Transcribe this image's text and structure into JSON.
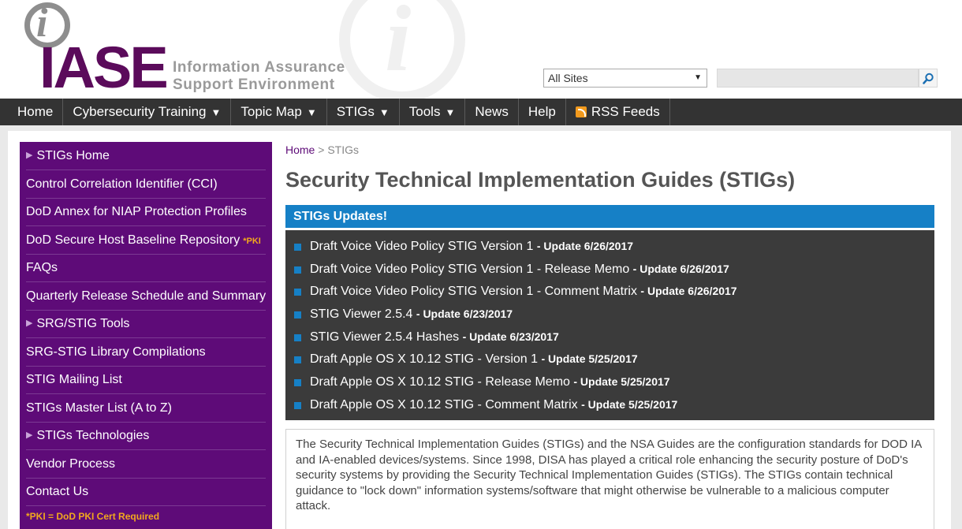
{
  "header": {
    "logo_wordmark": "IASE",
    "tagline_line1": "Information Assurance",
    "tagline_line2": "Support Environment",
    "site_select_value": "All Sites",
    "search_value": ""
  },
  "nav": {
    "items": [
      {
        "label": "Home",
        "dropdown": false
      },
      {
        "label": "Cybersecurity Training",
        "dropdown": true
      },
      {
        "label": "Topic Map",
        "dropdown": true
      },
      {
        "label": "STIGs",
        "dropdown": true
      },
      {
        "label": "Tools",
        "dropdown": true
      },
      {
        "label": "News",
        "dropdown": false
      },
      {
        "label": "Help",
        "dropdown": false
      },
      {
        "label": "RSS Feeds",
        "dropdown": false,
        "icon": "rss-icon"
      }
    ],
    "dropdown_glyph": "▼"
  },
  "sidebar": {
    "items": [
      {
        "label": "STIGs Home",
        "expandable": true
      },
      {
        "label": "Control Correlation Identifier (CCI)",
        "expandable": false
      },
      {
        "label": "DoD Annex for NIAP Protection Profiles",
        "expandable": false
      },
      {
        "label": "DoD Secure Host Baseline Repository",
        "expandable": false,
        "tag": "*PKI"
      },
      {
        "label": "FAQs",
        "expandable": false
      },
      {
        "label": "Quarterly Release Schedule and Summary",
        "expandable": false
      },
      {
        "label": "SRG/STIG Tools",
        "expandable": true
      },
      {
        "label": "SRG-STIG Library Compilations",
        "expandable": false
      },
      {
        "label": "STIG Mailing List",
        "expandable": false
      },
      {
        "label": "STIGs Master List (A to Z)",
        "expandable": false
      },
      {
        "label": "STIGs Technologies",
        "expandable": true
      },
      {
        "label": "Vendor Process",
        "expandable": false
      },
      {
        "label": "Contact Us",
        "expandable": false
      }
    ],
    "note": "*PKI = DoD PKI Cert Required",
    "expand_glyph": "▶"
  },
  "main": {
    "breadcrumb_home": "Home",
    "breadcrumb_sep": ">",
    "breadcrumb_current": "STIGs",
    "title": "Security Technical Implementation Guides (STIGs)",
    "updates_header": "STIGs Updates!",
    "updates": [
      {
        "text": "Draft Voice Video Policy STIG Version 1",
        "date": "- Update 6/26/2017"
      },
      {
        "text": "Draft Voice Video Policy STIG Version 1 - Release Memo",
        "date": "- Update 6/26/2017"
      },
      {
        "text": "Draft Voice Video Policy STIG Version 1 - Comment Matrix",
        "date": "- Update 6/26/2017"
      },
      {
        "text": "STIG Viewer 2.5.4",
        "date": "- Update 6/23/2017"
      },
      {
        "text": "STIG Viewer 2.5.4 Hashes",
        "date": "- Update 6/23/2017"
      },
      {
        "text": "Draft Apple OS X 10.12 STIG - Version 1",
        "date": "- Update 5/25/2017"
      },
      {
        "text": "Draft Apple OS X 10.12 STIG - Release Memo",
        "date": "- Update 5/25/2017"
      },
      {
        "text": "Draft Apple OS X 10.12 STIG - Comment Matrix",
        "date": "- Update 5/25/2017"
      }
    ],
    "description": "The Security Technical Implementation Guides (STIGs) and the NSA Guides are the configuration standards for DOD IA and IA-enabled devices/systems. Since 1998, DISA has played a critical role enhancing the security posture of DoD's security systems by providing the Security Technical Implementation Guides (STIGs). The STIGs contain technical guidance to \"lock down\" information systems/software that might otherwise be vulnerable to a malicious computer attack."
  },
  "colors": {
    "brand_purple": "#5e0b78",
    "nav_bg": "#333333",
    "accent_blue": "#1680c6",
    "updates_bg": "#3b3b3b",
    "pki_orange": "#f2a81d"
  }
}
